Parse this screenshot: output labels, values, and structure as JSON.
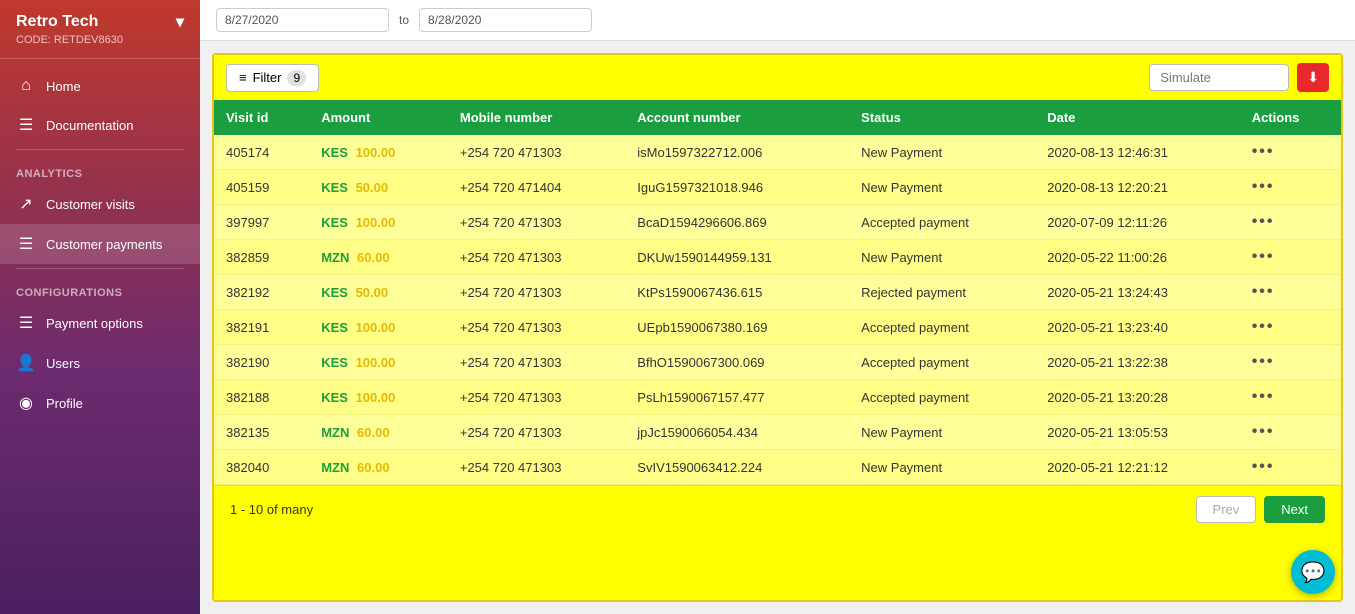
{
  "sidebar": {
    "brand": {
      "name": "Retro Tech",
      "code": "CODE: RETDEV8630",
      "chevron": "▾"
    },
    "nav_items": [
      {
        "id": "home",
        "label": "Home",
        "icon": "⌂"
      },
      {
        "id": "documentation",
        "label": "Documentation",
        "icon": "☰"
      }
    ],
    "analytics_label": "Analytics",
    "analytics_items": [
      {
        "id": "customer-visits",
        "label": "Customer visits",
        "icon": "↗"
      },
      {
        "id": "customer-payments",
        "label": "Customer payments",
        "icon": "☰",
        "active": true
      }
    ],
    "configurations_label": "Configurations",
    "config_items": [
      {
        "id": "payment-options",
        "label": "Payment options",
        "icon": "☰"
      },
      {
        "id": "users",
        "label": "Users",
        "icon": "👤"
      },
      {
        "id": "profile",
        "label": "Profile",
        "icon": "◉"
      }
    ]
  },
  "date_bar": {
    "from_date": "8/27/2020",
    "to_date": "8/28/2020",
    "separator": "to"
  },
  "filter_bar": {
    "filter_label": "Filter",
    "filter_count": "9",
    "simulate_placeholder": "Simulate",
    "download_icon": "⬇"
  },
  "table": {
    "headers": [
      {
        "id": "visit_id",
        "label": "Visit id"
      },
      {
        "id": "amount",
        "label": "Amount"
      },
      {
        "id": "mobile_number",
        "label": "Mobile number"
      },
      {
        "id": "account_number",
        "label": "Account number"
      },
      {
        "id": "status",
        "label": "Status"
      },
      {
        "id": "date",
        "label": "Date"
      },
      {
        "id": "actions",
        "label": "Actions"
      }
    ],
    "rows": [
      {
        "visit_id": "405174",
        "currency": "KES",
        "amount": "100.00",
        "mobile": "+254 720 471303",
        "account": "isMo1597322712.006",
        "status": "New Payment",
        "date": "2020-08-13 12:46:31"
      },
      {
        "visit_id": "405159",
        "currency": "KES",
        "amount": "50.00",
        "mobile": "+254 720 471404",
        "account": "IguG1597321018.946",
        "status": "New Payment",
        "date": "2020-08-13 12:20:21"
      },
      {
        "visit_id": "397997",
        "currency": "KES",
        "amount": "100.00",
        "mobile": "+254 720 471303",
        "account": "BcaD1594296606.869",
        "status": "Accepted payment",
        "date": "2020-07-09 12:11:26"
      },
      {
        "visit_id": "382859",
        "currency": "MZN",
        "amount": "60.00",
        "mobile": "+254 720 471303",
        "account": "DKUw1590144959.131",
        "status": "New Payment",
        "date": "2020-05-22 11:00:26"
      },
      {
        "visit_id": "382192",
        "currency": "KES",
        "amount": "50.00",
        "mobile": "+254 720 471303",
        "account": "KtPs1590067436.615",
        "status": "Rejected payment",
        "date": "2020-05-21 13:24:43"
      },
      {
        "visit_id": "382191",
        "currency": "KES",
        "amount": "100.00",
        "mobile": "+254 720 471303",
        "account": "UEpb1590067380.169",
        "status": "Accepted payment",
        "date": "2020-05-21 13:23:40"
      },
      {
        "visit_id": "382190",
        "currency": "KES",
        "amount": "100.00",
        "mobile": "+254 720 471303",
        "account": "BfhO1590067300.069",
        "status": "Accepted payment",
        "date": "2020-05-21 13:22:38"
      },
      {
        "visit_id": "382188",
        "currency": "KES",
        "amount": "100.00",
        "mobile": "+254 720 471303",
        "account": "PsLh1590067157.477",
        "status": "Accepted payment",
        "date": "2020-05-21 13:20:28"
      },
      {
        "visit_id": "382135",
        "currency": "MZN",
        "amount": "60.00",
        "mobile": "+254 720 471303",
        "account": "jpJc1590066054.434",
        "status": "New Payment",
        "date": "2020-05-21 13:05:53"
      },
      {
        "visit_id": "382040",
        "currency": "MZN",
        "amount": "60.00",
        "mobile": "+254 720 471303",
        "account": "SvIV1590063412.224",
        "status": "New Payment",
        "date": "2020-05-21 12:21:12"
      }
    ],
    "actions_label": "•••"
  },
  "pagination": {
    "info": "1 - 10  of  many",
    "prev_label": "Prev",
    "next_label": "Next"
  },
  "chat": {
    "icon": "💬"
  }
}
